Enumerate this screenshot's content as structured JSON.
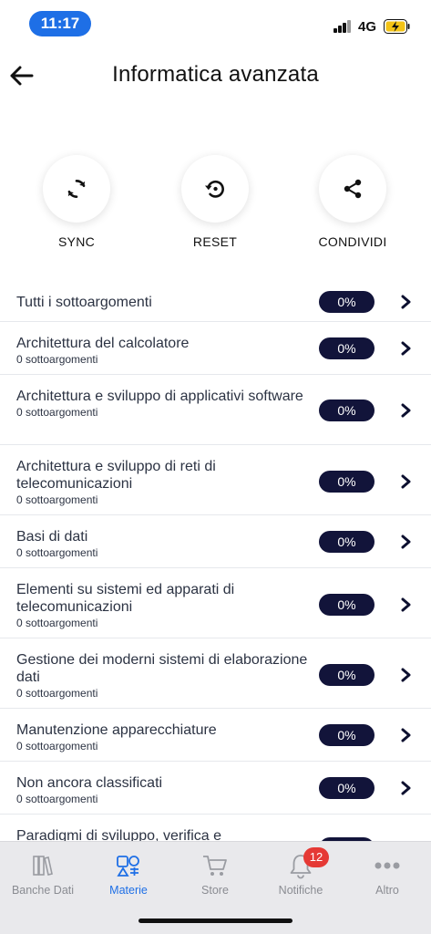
{
  "status_bar": {
    "time": "11:17",
    "network": "4G",
    "icons": [
      "signal-icon",
      "battery-charging-icon"
    ]
  },
  "header": {
    "title": "Informatica avanzata",
    "back_icon": "arrow-left-icon"
  },
  "actions": [
    {
      "label": "SYNC",
      "icon": "sync-icon"
    },
    {
      "label": "RESET",
      "icon": "reset-icon"
    },
    {
      "label": "CONDIVIDI",
      "icon": "share-icon"
    }
  ],
  "topics": [
    {
      "name": "Tutti i sottoargomenti",
      "sub": "",
      "progress": "0%"
    },
    {
      "name": "Architettura del calcolatore",
      "sub": "0 sottoargomenti",
      "progress": "0%"
    },
    {
      "name": "Architettura e sviluppo di applicativi software",
      "sub": "0 sottoargomenti",
      "progress": "0%"
    },
    {
      "name": "Architettura e sviluppo di reti di telecomunicazioni",
      "sub": "0 sottoargomenti",
      "progress": "0%"
    },
    {
      "name": "Basi di dati",
      "sub": "0 sottoargomenti",
      "progress": "0%"
    },
    {
      "name": "Elementi su sistemi ed apparati di telecomunicazioni",
      "sub": "0 sottoargomenti",
      "progress": "0%"
    },
    {
      "name": "Gestione dei moderni sistemi di elaborazione dati",
      "sub": "0 sottoargomenti",
      "progress": "0%"
    },
    {
      "name": "Manutenzione apparecchiature",
      "sub": "0 sottoargomenti",
      "progress": "0%"
    },
    {
      "name": "Non ancora classificati",
      "sub": "0 sottoargomenti",
      "progress": "0%"
    },
    {
      "name": "Paradigmi di sviluppo, verifica e",
      "sub": "",
      "progress": ""
    }
  ],
  "tabbar": {
    "tabs": [
      {
        "label": "Banche Dati",
        "icon": "books-icon",
        "active": false
      },
      {
        "label": "Materie",
        "icon": "subjects-icon",
        "active": true
      },
      {
        "label": "Store",
        "icon": "cart-icon",
        "active": false
      },
      {
        "label": "Notifiche",
        "icon": "bell-icon",
        "active": false,
        "badge": "12"
      },
      {
        "label": "Altro",
        "icon": "more-icon",
        "active": false
      }
    ]
  },
  "colors": {
    "accent": "#1e6fe6",
    "pill": "#12143a",
    "badge": "#e53935",
    "inactive": "#8a8c92"
  }
}
